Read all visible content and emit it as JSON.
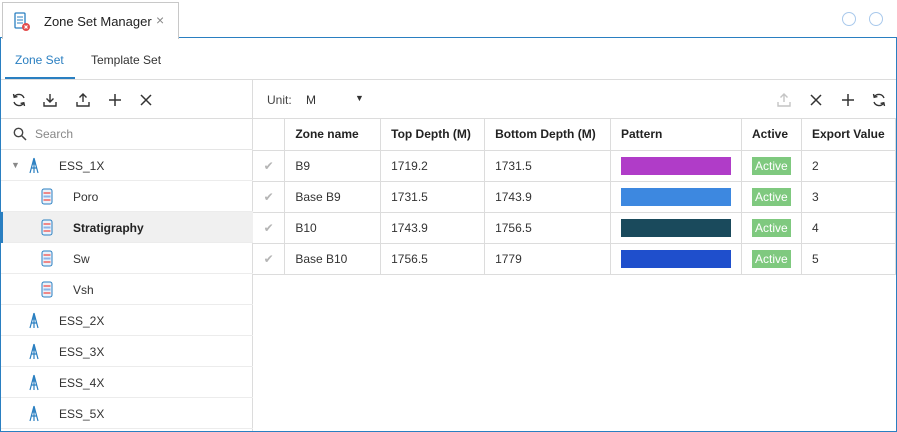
{
  "window": {
    "tab_title": "Zone Set Manager",
    "tab_close": "×",
    "icons": [
      "zone-manager-icon",
      "close-icon",
      "restore-icon",
      "close-circle-icon"
    ]
  },
  "subtabs": [
    {
      "label": "Zone Set",
      "active": true
    },
    {
      "label": "Template Set",
      "active": false
    }
  ],
  "left_toolbar": [
    "refresh-icon",
    "import-icon",
    "export-icon",
    "add-icon",
    "close-icon"
  ],
  "search": {
    "placeholder": "Search",
    "value": ""
  },
  "tree": [
    {
      "label": "ESS_1X",
      "type": "well",
      "expanded": true,
      "level": 0
    },
    {
      "label": "Poro",
      "type": "zone-set",
      "level": 1
    },
    {
      "label": "Stratigraphy",
      "type": "zone-set",
      "level": 1,
      "selected": true
    },
    {
      "label": "Sw",
      "type": "zone-set",
      "level": 1
    },
    {
      "label": "Vsh",
      "type": "zone-set",
      "level": 1
    },
    {
      "label": "ESS_2X",
      "type": "well",
      "level": 0
    },
    {
      "label": "ESS_3X",
      "type": "well",
      "level": 0
    },
    {
      "label": "ESS_4X",
      "type": "well",
      "level": 0
    },
    {
      "label": "ESS_5X",
      "type": "well",
      "level": 0
    }
  ],
  "right_toolbar": {
    "unit_label": "Unit:",
    "unit_value": "M",
    "icons": [
      "export-icon",
      "close-icon",
      "add-icon",
      "refresh-icon"
    ]
  },
  "table": {
    "headers": [
      "",
      "Zone name",
      "Top Depth (M)",
      "Bottom Depth (M)",
      "Pattern",
      "Active",
      "Export Value"
    ],
    "rows": [
      {
        "check": "✔",
        "name": "B9",
        "top": "1719.2",
        "bottom": "1731.5",
        "color": "#b03cc8",
        "active": "Active",
        "export": "2"
      },
      {
        "check": "✔",
        "name": "Base B9",
        "top": "1731.5",
        "bottom": "1743.9",
        "color": "#3d88e0",
        "active": "Active",
        "export": "3"
      },
      {
        "check": "✔",
        "name": "B10",
        "top": "1743.9",
        "bottom": "1756.5",
        "color": "#1a4a5c",
        "active": "Active",
        "export": "4"
      },
      {
        "check": "✔",
        "name": "Base B10",
        "top": "1756.5",
        "bottom": "1779",
        "color": "#1f4fcc",
        "active": "Active",
        "export": "5"
      }
    ]
  },
  "colors": {
    "accent": "#2a7fc1",
    "active_badge": "#7fc97f",
    "icon_blue": "#2a7fc1"
  }
}
